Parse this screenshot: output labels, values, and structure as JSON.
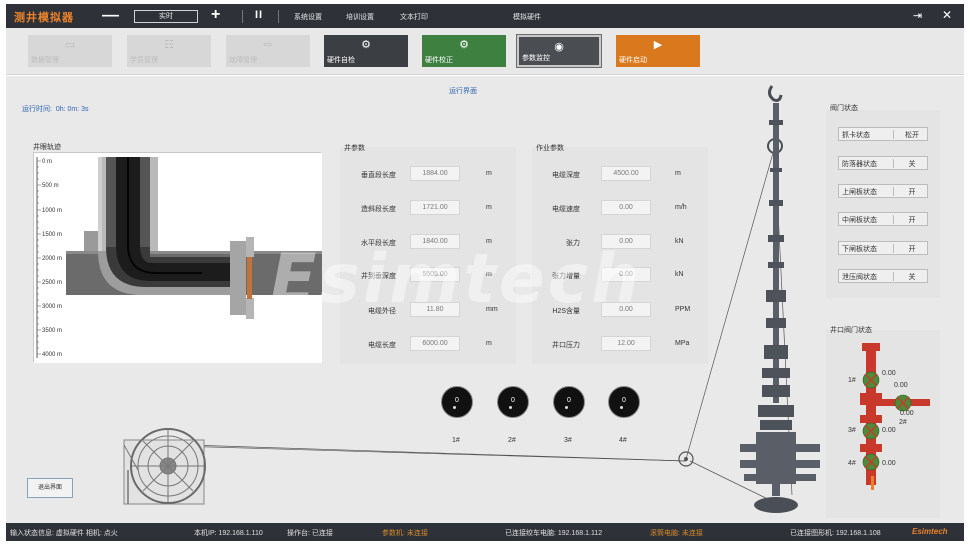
{
  "app": {
    "brand": "测井模拟器",
    "speed_value": "实时",
    "minus_glyph": "—",
    "plus_glyph": "+",
    "pause_glyph": "II",
    "menus": [
      "系统设置",
      "培训设置",
      "文本打印"
    ],
    "window_title": "模拟硬件",
    "exit_glyph": "⇥",
    "close_glyph": "✕"
  },
  "toolbar": [
    {
      "label": "数据管理",
      "icon": "▭"
    },
    {
      "label": "学员管理",
      "icon": "☷"
    },
    {
      "label": "故障管理",
      "icon": "⇨"
    },
    {
      "label": "硬件自检",
      "icon": "⚙"
    },
    {
      "label": "硬件校正",
      "icon": "⚙"
    },
    {
      "label": "参数监控",
      "icon": "◉"
    },
    {
      "label": "硬件启动",
      "icon": "▶"
    }
  ],
  "main": {
    "title": "运行界面",
    "runtime_label": "运行时间:",
    "runtime_value": "0h: 0m: 3s",
    "well_trajectory_title": "井眼轨迹",
    "depth_ticks": [
      "0 m",
      "500 m",
      "1000 m",
      "1500 m",
      "2000 m",
      "2500 m",
      "3000 m",
      "3500 m",
      "4000 m"
    ]
  },
  "well_params": {
    "title": "井参数",
    "rows": [
      {
        "label": "垂直段长度",
        "value": "1884.00",
        "unit": "m"
      },
      {
        "label": "造斜段长度",
        "value": "1721.00",
        "unit": "m"
      },
      {
        "label": "水平段长度",
        "value": "1840.00",
        "unit": "m"
      },
      {
        "label": "井到垂深度",
        "value": "5505.00",
        "unit": "m"
      },
      {
        "label": "电缆外径",
        "value": "11.80",
        "unit": "mm"
      },
      {
        "label": "电缆长度",
        "value": "6000.00",
        "unit": "m"
      }
    ]
  },
  "work_params": {
    "title": "作业参数",
    "rows": [
      {
        "label": "电缆深度",
        "value": "4500.00",
        "unit": "m"
      },
      {
        "label": "电缆速度",
        "value": "0.00",
        "unit": "m/h"
      },
      {
        "label": "张力",
        "value": "0.00",
        "unit": "kN"
      },
      {
        "label": "张力增量",
        "value": "0.00",
        "unit": "kN"
      },
      {
        "label": "H2S含量",
        "value": "0.00",
        "unit": "PPM"
      },
      {
        "label": "井口压力",
        "value": "12.00",
        "unit": "MPa"
      }
    ]
  },
  "gauges": [
    {
      "label": "1#",
      "value": "0"
    },
    {
      "label": "2#",
      "value": "0"
    },
    {
      "label": "3#",
      "value": "0"
    },
    {
      "label": "4#",
      "value": "0"
    }
  ],
  "valve_status": {
    "title": "阀门状态",
    "rows": [
      {
        "label": "抓卡状态",
        "value": "松开"
      },
      {
        "label": "防落器状态",
        "value": "关"
      },
      {
        "label": "上闸板状态",
        "value": "开"
      },
      {
        "label": "中闸板状态",
        "value": "开"
      },
      {
        "label": "下闸板状态",
        "value": "开"
      },
      {
        "label": "泄压阀状态",
        "value": "关"
      }
    ]
  },
  "wellhead": {
    "title": "井口阀门状态",
    "valves": [
      {
        "label": "1#",
        "value": "0.00"
      },
      {
        "label": "",
        "value": "0.00"
      },
      {
        "label": "2#",
        "value": "0.00"
      },
      {
        "label": "3#",
        "value": "0.00"
      },
      {
        "label": "4#",
        "value": "0.00"
      }
    ]
  },
  "escape_button": "退出界面",
  "watermark": "Esimtech",
  "statusbar": {
    "items": [
      {
        "text": "输入状态信息: 虚拟硬件  相机: 点火",
        "warn": false
      },
      {
        "text": "本机IP: 192.168.1.110",
        "warn": false
      },
      {
        "text": "操作台: 已连接",
        "warn": false
      },
      {
        "text": "参数机: 未连接",
        "warn": true
      },
      {
        "text": "已连接绞车电脑: 192.168.1.112",
        "warn": false
      },
      {
        "text": "滚筒电脑: 未连接",
        "warn": true
      },
      {
        "text": "已连接图形机: 192.168.1.108",
        "warn": false
      }
    ],
    "brand": "Esimtech"
  },
  "colors": {
    "accent": "#e9822a",
    "dark": "#2e3238",
    "green": "#3d8040",
    "orange": "#d9781c",
    "valve_red": "#d23a2a",
    "valve_green": "#4a8a3a"
  }
}
